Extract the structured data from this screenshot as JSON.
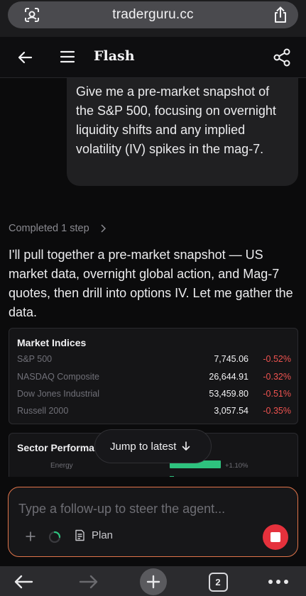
{
  "browser": {
    "url": "traderguru.cc",
    "tab_count": "2"
  },
  "header": {
    "title": "Flash"
  },
  "chat": {
    "user_message": "Give me a pre-market snapshot of the S&P 500, focusing on overnight liquidity shifts and any implied volatility (IV) spikes in the mag-7.",
    "completed_label": "Completed 1 step",
    "assistant_message": "I'll pull together a pre-market snapshot — US market data, overnight global action, and Mag-7 quotes, then drill into options IV. Let me gather the data."
  },
  "market_indices": {
    "title": "Market Indices",
    "rows": [
      {
        "name": "S&P 500",
        "value": "7,745.06",
        "change": "-0.52%"
      },
      {
        "name": "NASDAQ Composite",
        "value": "26,644.91",
        "change": "-0.32%"
      },
      {
        "name": "Dow Jones Industrial",
        "value": "53,459.80",
        "change": "-0.51%"
      },
      {
        "name": "Russell 2000",
        "value": "3,057.54",
        "change": "-0.35%"
      }
    ]
  },
  "sector_performance": {
    "title": "Sector Performance",
    "rows": [
      {
        "name": "Energy",
        "change": "+1.10%"
      }
    ]
  },
  "jump_button": {
    "label": "Jump to latest"
  },
  "composer": {
    "placeholder": "Type a follow-up to steer the agent...",
    "plan_label": "Plan"
  },
  "colors": {
    "accent_border": "#e0744a",
    "negative": "#ef5350",
    "positive": "#2ec27e",
    "stop_button": "#e5313c"
  }
}
